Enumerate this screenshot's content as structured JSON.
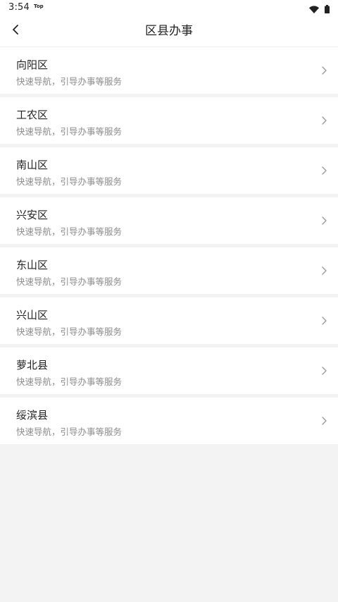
{
  "status_bar": {
    "time": "3:54",
    "notification": "Top",
    "icons": [
      "wifi-icon",
      "battery-icon"
    ]
  },
  "header": {
    "title": "区县办事",
    "back_icon": "chevron-left-icon"
  },
  "items": [
    {
      "title": "向阳区",
      "subtitle": "快速导航，引导办事等服务"
    },
    {
      "title": "工农区",
      "subtitle": "快速导航，引导办事等服务"
    },
    {
      "title": "南山区",
      "subtitle": "快速导航，引导办事等服务"
    },
    {
      "title": "兴安区",
      "subtitle": "快速导航，引导办事等服务"
    },
    {
      "title": "东山区",
      "subtitle": "快速导航，引导办事等服务"
    },
    {
      "title": "兴山区",
      "subtitle": "快速导航，引导办事等服务"
    },
    {
      "title": "萝北县",
      "subtitle": "快速导航，引导办事等服务"
    },
    {
      "title": "绥滨县",
      "subtitle": "快速导航，引导办事等服务"
    }
  ],
  "colors": {
    "background": "#f3f3f3",
    "card": "#ffffff",
    "title_text": "#222222",
    "subtitle_text": "#8c8c8c",
    "chevron": "#9a9a9a"
  }
}
